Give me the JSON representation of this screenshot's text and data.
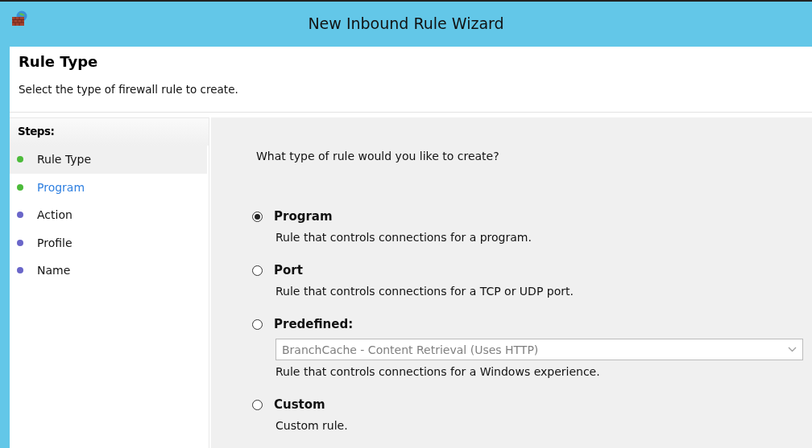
{
  "window": {
    "title": "New Inbound Rule Wizard"
  },
  "header": {
    "title": "Rule Type",
    "subtitle": "Select the type of firewall rule to create."
  },
  "steps": {
    "heading": "Steps:",
    "items": [
      {
        "label": "Rule Type",
        "selected": true,
        "hovered": false,
        "color": "#4cbb3a"
      },
      {
        "label": "Program",
        "selected": false,
        "hovered": true,
        "color": "#4cbb3a"
      },
      {
        "label": "Action",
        "selected": false,
        "hovered": false,
        "color": "#6a66c9"
      },
      {
        "label": "Profile",
        "selected": false,
        "hovered": false,
        "color": "#6a66c9"
      },
      {
        "label": "Name",
        "selected": false,
        "hovered": false,
        "color": "#6a66c9"
      }
    ]
  },
  "question": "What type of rule would you like to create?",
  "options": [
    {
      "label": "Program",
      "selected": true,
      "description": "Rule that controls connections for a program."
    },
    {
      "label": "Port",
      "selected": false,
      "description": "Rule that controls connections for a TCP or UDP port."
    },
    {
      "label": "Predefined:",
      "selected": false,
      "dropdown": {
        "value": "BranchCache - Content Retrieval (Uses HTTP)",
        "disabled": true
      },
      "description": "Rule that controls connections for a Windows experience."
    },
    {
      "label": "Custom",
      "selected": false,
      "description": "Custom rule."
    }
  ]
}
